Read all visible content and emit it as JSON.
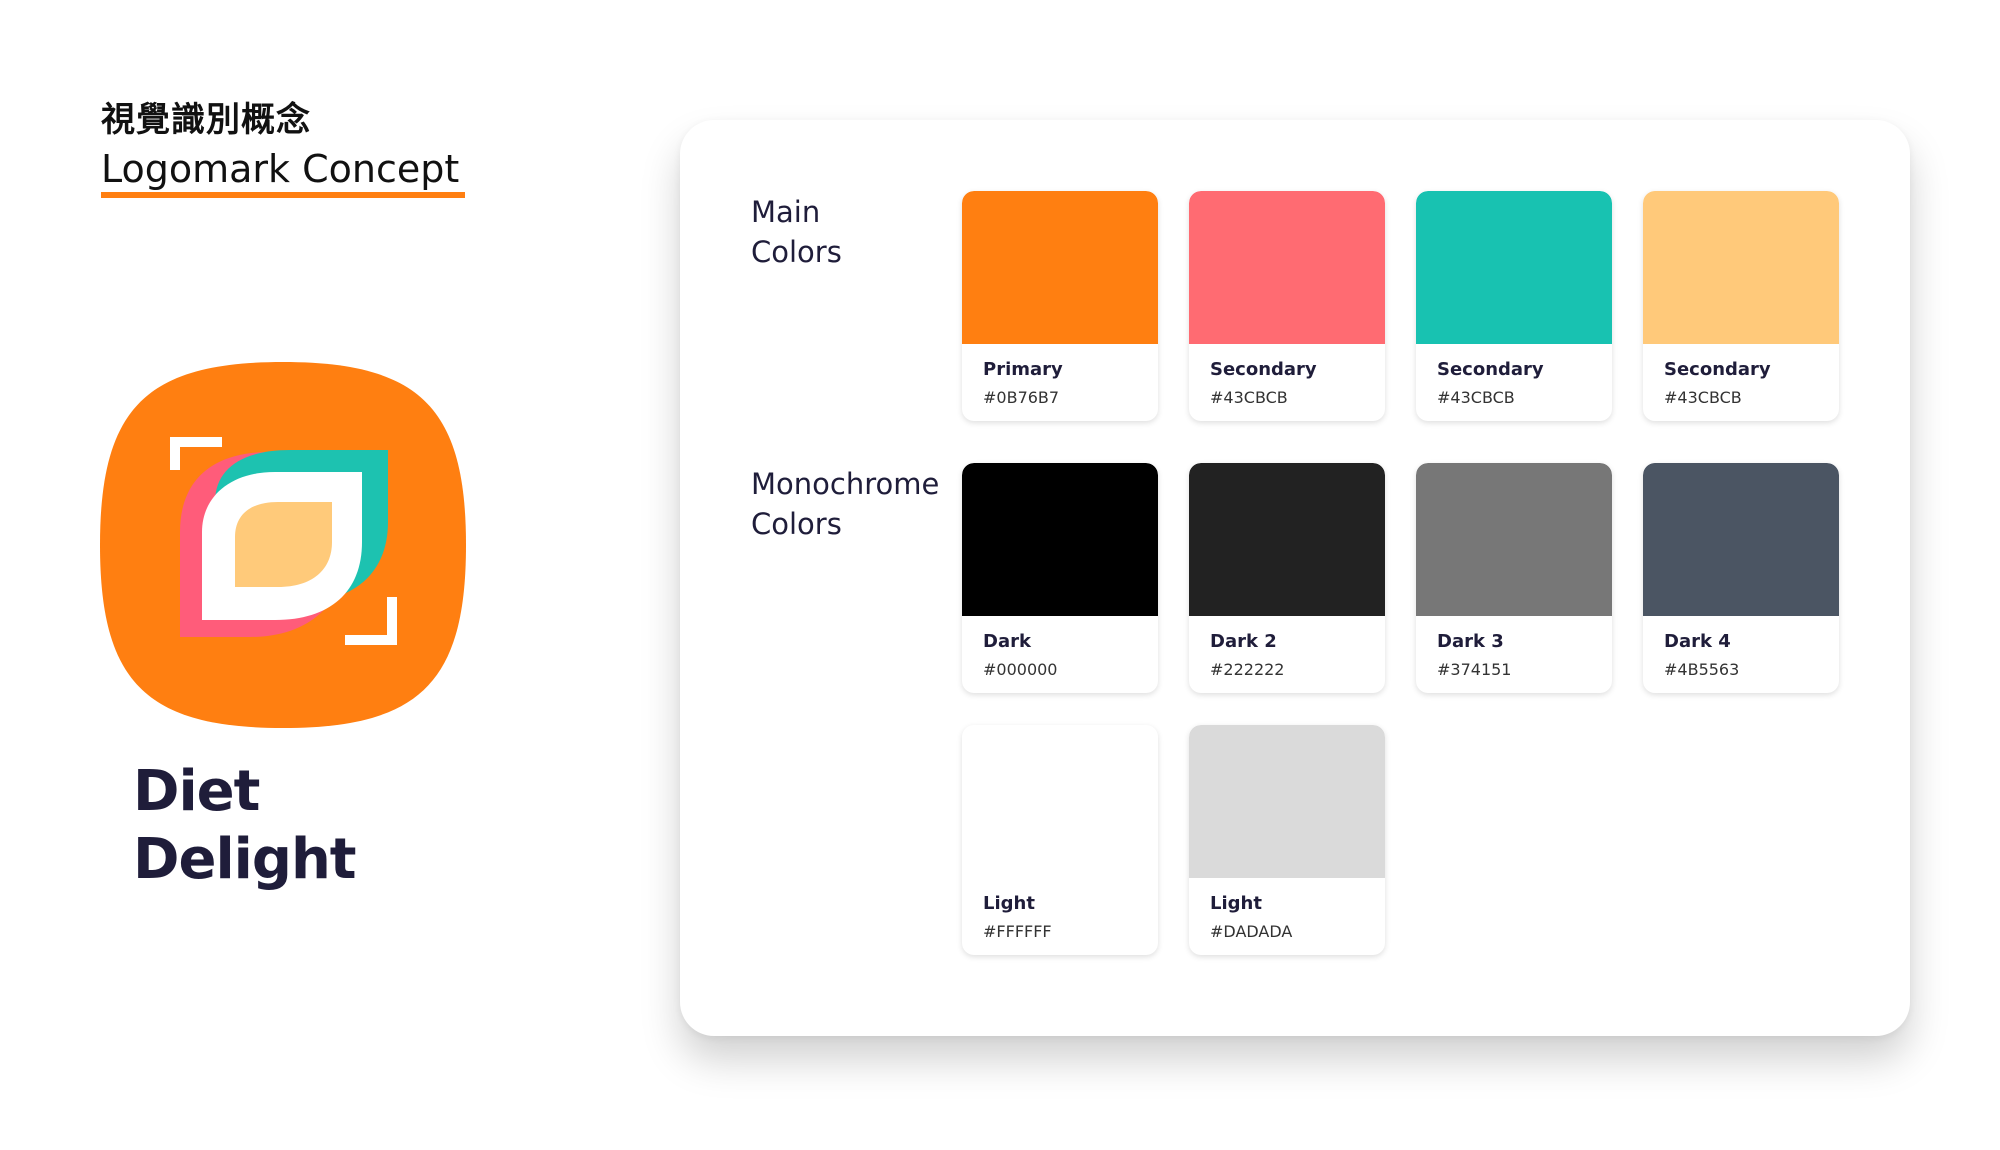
{
  "header": {
    "title_zh": "視覺識別概念",
    "title_en": "Logomark Concept"
  },
  "brand": {
    "name_line1": "Diet",
    "name_line2": "Delight",
    "logo_colors": {
      "background": "#FF7F11",
      "leaf_teal": "#1DC2B0",
      "leaf_pink": "#FF5C7A",
      "leaf_inner": "#FFCA7A",
      "outline": "#FFFFFF"
    }
  },
  "palette": {
    "main": {
      "label_line1": "Main",
      "label_line2": "Colors",
      "swatches": [
        {
          "name": "Primary",
          "hex_label": "#0B76B7",
          "color": "#FF7F11"
        },
        {
          "name": "Secondary",
          "hex_label": "#43CBCB",
          "color": "#FF6B72"
        },
        {
          "name": "Secondary",
          "hex_label": "#43CBCB",
          "color": "#18C2B1"
        },
        {
          "name": "Secondary",
          "hex_label": "#43CBCB",
          "color": "#FFC97A"
        }
      ]
    },
    "mono": {
      "label_line1": "Monochrome",
      "label_line2": "Colors",
      "swatches": [
        {
          "name": "Dark",
          "hex_label": "#000000",
          "color": "#000000"
        },
        {
          "name": "Dark 2",
          "hex_label": "#222222",
          "color": "#222222"
        },
        {
          "name": "Dark 3",
          "hex_label": "#374151",
          "color": "#777777"
        },
        {
          "name": "Dark 4",
          "hex_label": "#4B5563",
          "color": "#4B5563"
        },
        {
          "name": "Light",
          "hex_label": "#FFFFFF",
          "color": "#FFFFFF"
        },
        {
          "name": "Light",
          "hex_label": "#DADADA",
          "color": "#DADADA"
        }
      ]
    }
  }
}
